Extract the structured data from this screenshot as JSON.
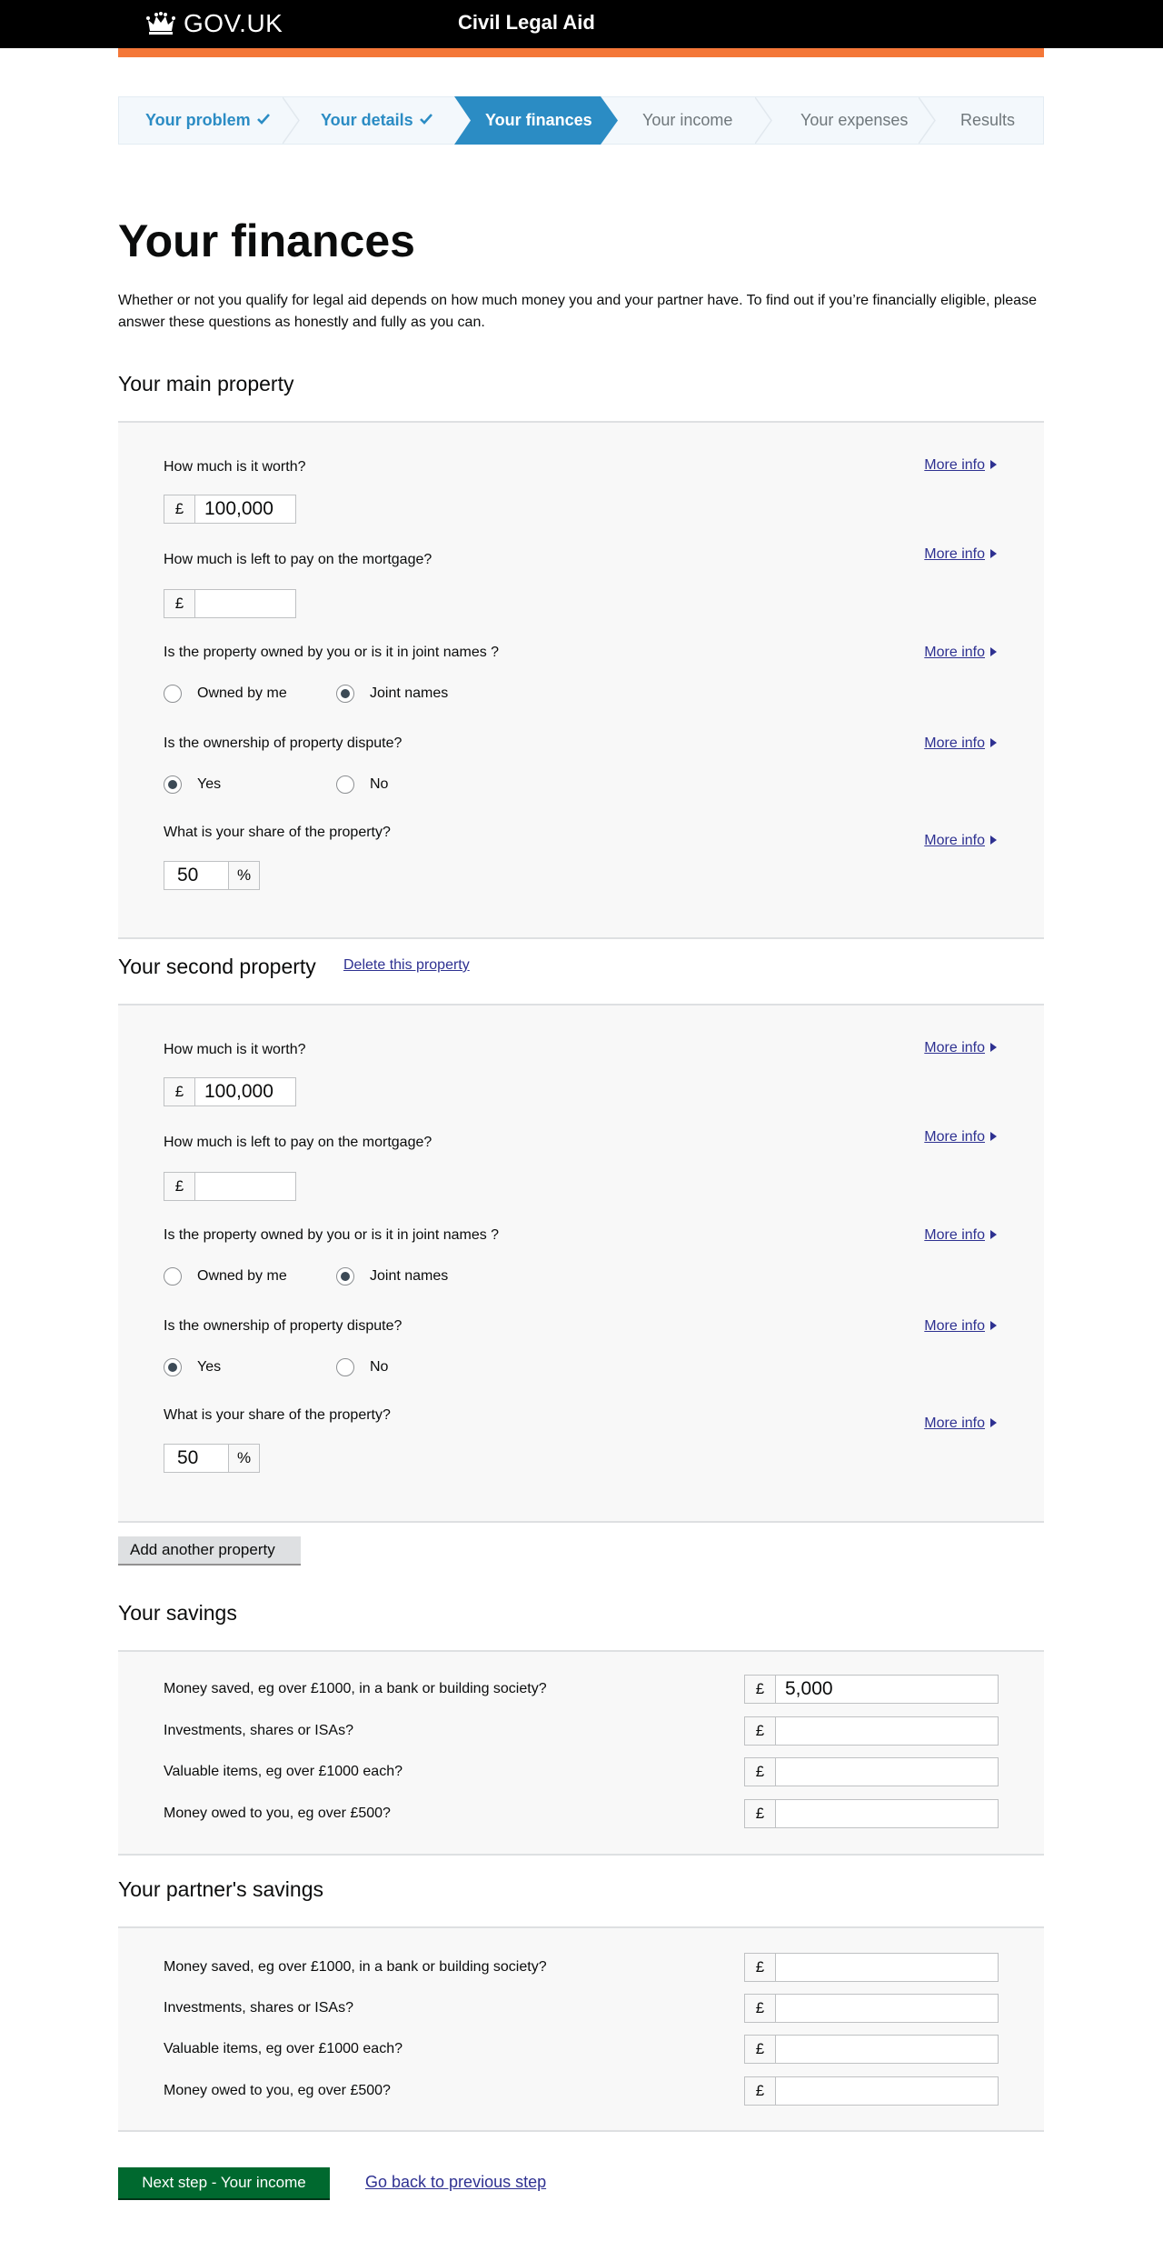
{
  "header": {
    "logo_text": "GOV.UK",
    "service_name": "Civil Legal Aid"
  },
  "steps": [
    {
      "label": "Your problem",
      "state": "done"
    },
    {
      "label": "Your details",
      "state": "done"
    },
    {
      "label": "Your finances",
      "state": "current"
    },
    {
      "label": "Your income",
      "state": "future"
    },
    {
      "label": "Your expenses",
      "state": "future"
    },
    {
      "label": "Results",
      "state": "future"
    }
  ],
  "page": {
    "title": "Your finances",
    "intro": "Whether or not you qualify for legal aid depends on how much money you and your partner have. To find out if you’re financially eligible, please answer these questions as honestly and fully as you can."
  },
  "more_info_label": "More info",
  "currency_symbol": "£",
  "percent_symbol": "%",
  "main_property": {
    "title": "Your main property",
    "worth_q": "How much is it worth?",
    "worth_value": "100,000",
    "mortgage_q": "How much is left to pay on the mortgage?",
    "mortgage_value": "",
    "owned_q": "Is the property owned by you or is it in joint names ?",
    "owned_opt1": "Owned by me",
    "owned_opt2": "Joint names",
    "owned_selected": "Joint names",
    "dispute_q": "Is the ownership of property dispute?",
    "dispute_opt1": "Yes",
    "dispute_opt2": "No",
    "dispute_selected": "Yes",
    "share_q": "What is your share of the property?",
    "share_value": "50"
  },
  "second_property": {
    "title": "Your second property",
    "delete_label": "Delete this property",
    "worth_q": "How much is it worth?",
    "worth_value": "100,000",
    "mortgage_q": "How much is left to pay on the mortgage?",
    "mortgage_value": "",
    "owned_q": "Is the property owned by you or is it in joint names ?",
    "owned_opt1": "Owned by me",
    "owned_opt2": "Joint names",
    "owned_selected": "Joint names",
    "dispute_q": "Is the ownership of property dispute?",
    "dispute_opt1": "Yes",
    "dispute_opt2": "No",
    "dispute_selected": "Yes",
    "share_q": "What is your share of the property?",
    "share_value": "50"
  },
  "add_property_label": "Add another property",
  "savings": {
    "title": "Your savings",
    "rows": [
      {
        "label": "Money saved, eg over £1000, in a bank or building society?",
        "value": "5,000"
      },
      {
        "label": "Investments, shares or ISAs?",
        "value": ""
      },
      {
        "label": "Valuable items, eg over £1000 each?",
        "value": ""
      },
      {
        "label": "Money owed to you, eg over £500?",
        "value": ""
      }
    ]
  },
  "partner_savings": {
    "title": "Your partner's savings",
    "rows": [
      {
        "label": "Money saved, eg over £1000, in a bank or building society?",
        "value": ""
      },
      {
        "label": "Investments, shares or ISAs?",
        "value": ""
      },
      {
        "label": "Valuable items, eg over £1000 each?",
        "value": ""
      },
      {
        "label": "Money owed to you, eg over £500?",
        "value": ""
      }
    ]
  },
  "actions": {
    "next_label": "Next step - Your income",
    "back_label": "Go back to previous step"
  }
}
